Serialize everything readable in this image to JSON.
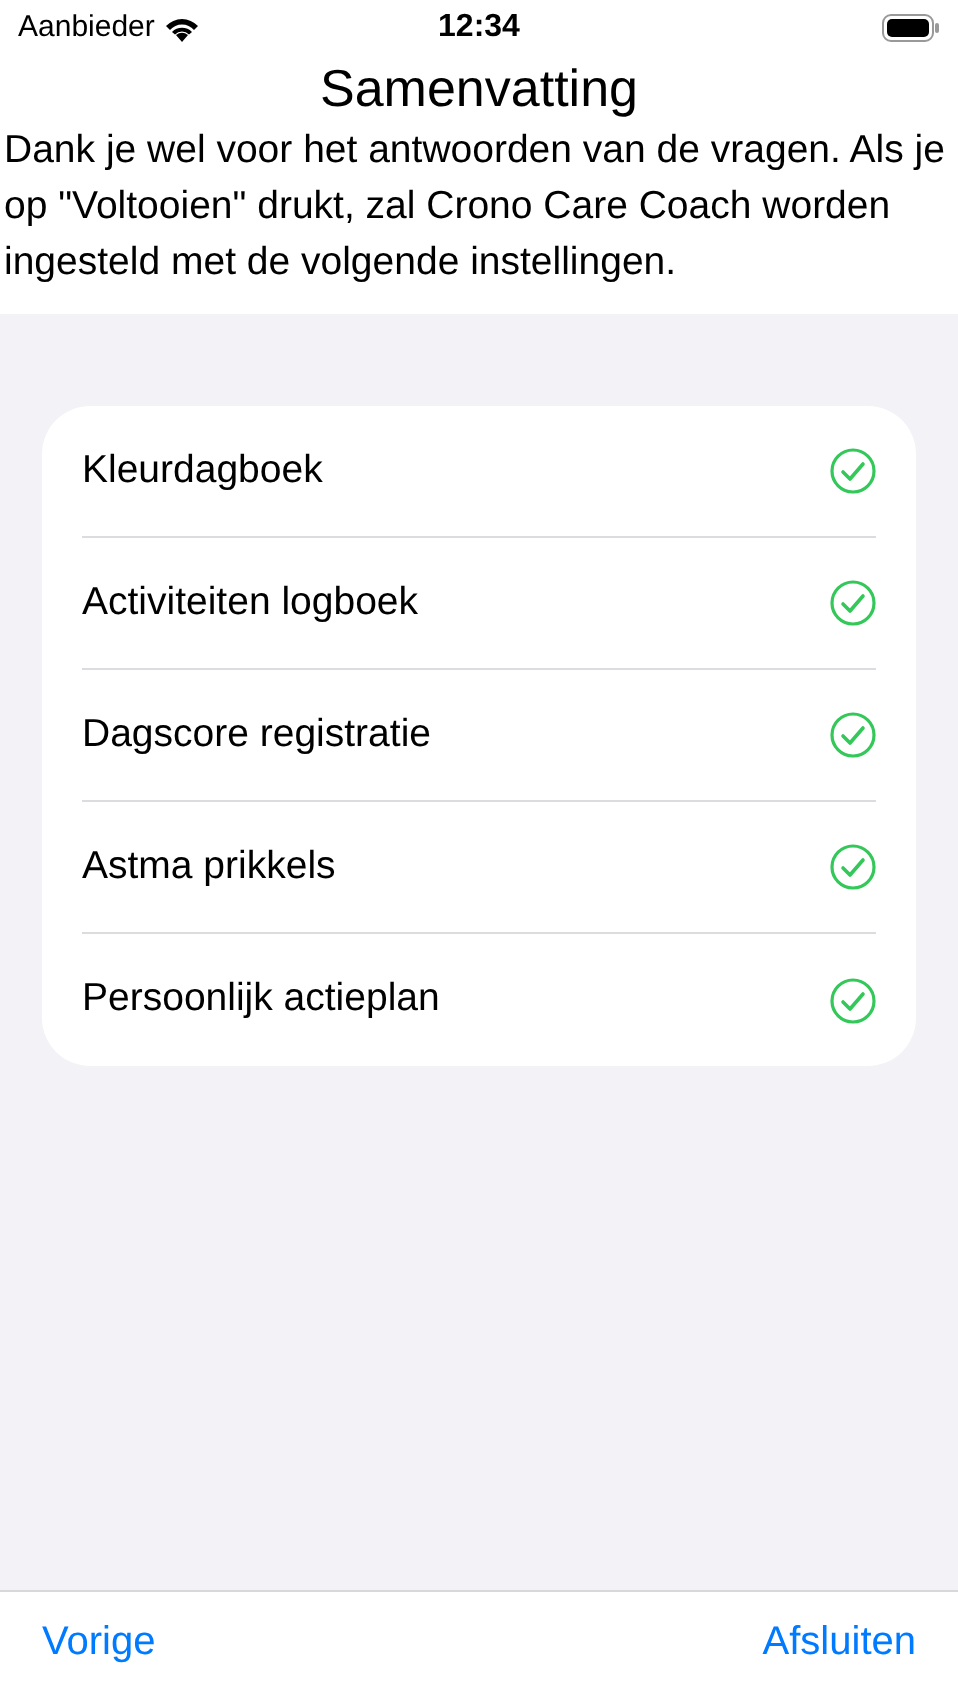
{
  "status_bar": {
    "carrier": "Aanbieder",
    "time": "12:34"
  },
  "title": "Samenvatting",
  "intro": "Dank je wel voor het antwoorden van de vragen. Als je op \"Voltooien\" drukt, zal Crono Care Coach worden ingesteld met de volgende instellingen.",
  "settings": [
    {
      "label": "Kleurdagboek",
      "checked": true
    },
    {
      "label": "Activiteiten logboek",
      "checked": true
    },
    {
      "label": "Dagscore registratie",
      "checked": true
    },
    {
      "label": "Astma prikkels",
      "checked": true
    },
    {
      "label": "Persoonlijk actieplan",
      "checked": true
    }
  ],
  "toolbar": {
    "back": "Vorige",
    "finish": "Afsluiten"
  }
}
